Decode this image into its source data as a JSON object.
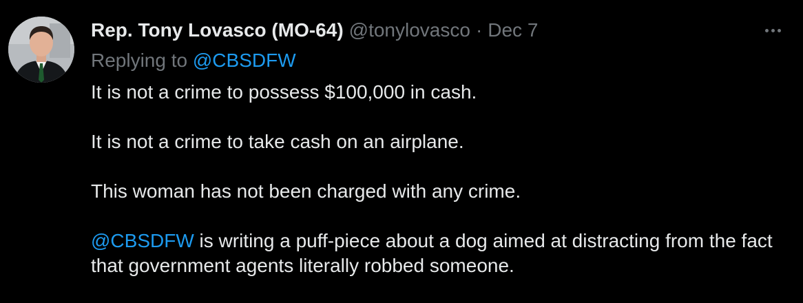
{
  "author": {
    "display_name": "Rep. Tony Lovasco (MO-64)",
    "handle": "@tonylovasco",
    "separator": "·",
    "date": "Dec 7",
    "avatar_icon": "user-avatar"
  },
  "menu": {
    "icon": "more-horizontal-icon"
  },
  "reply": {
    "prefix": "Replying to",
    "target": "@CBSDFW"
  },
  "tweet": {
    "p1": "It is not a crime to possess $100,000 in cash.",
    "p2": "It is not a crime to take cash on an airplane.",
    "p3": "This woman has not been charged with any crime.",
    "p4_mention": "@CBSDFW",
    "p4_rest": " is writing a puff-piece about a dog aimed at distracting from the fact that government agents literally robbed someone."
  },
  "colors": {
    "background": "#000000",
    "text": "#e7e9ea",
    "muted": "#71767b",
    "link": "#1d9bf0"
  }
}
